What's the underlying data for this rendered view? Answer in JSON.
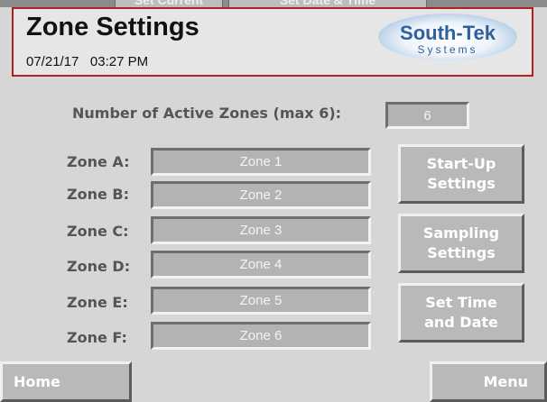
{
  "topbar": {
    "left_button": "Set Current",
    "right_button": "Set Date & Time"
  },
  "header": {
    "title": "Zone Settings",
    "date": "07/21/17",
    "time": "03:27 PM",
    "logo": {
      "brand": "South-Tek",
      "sub": "Systems"
    }
  },
  "active_zones": {
    "label": "Number of Active Zones (max 6):",
    "value": "6"
  },
  "zones": [
    {
      "label": "Zone A:",
      "value": "Zone 1"
    },
    {
      "label": "Zone B:",
      "value": "Zone 2"
    },
    {
      "label": "Zone C:",
      "value": "Zone 3"
    },
    {
      "label": "Zone D:",
      "value": "Zone 4"
    },
    {
      "label": "Zone E:",
      "value": "Zone 5"
    },
    {
      "label": "Zone F:",
      "value": "Zone 6"
    }
  ],
  "side_buttons": {
    "startup_line1": "Start-Up",
    "startup_line2": "Settings",
    "sampling_line1": "Sampling",
    "sampling_line2": "Settings",
    "settime_line1": "Set Time",
    "settime_line2": "and Date"
  },
  "footer": {
    "home": "Home",
    "menu": "Menu"
  }
}
